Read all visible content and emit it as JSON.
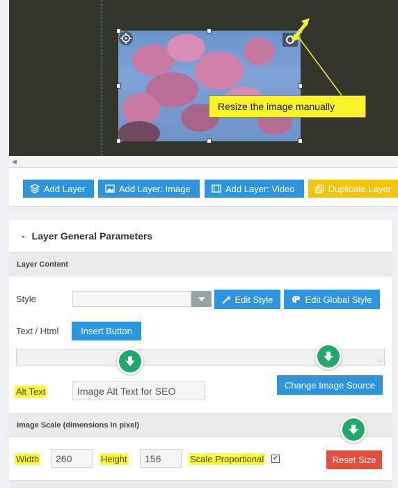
{
  "canvas": {
    "callout_text": "Resize the image manually"
  },
  "layer_buttons": [
    {
      "label": "Add Layer",
      "icon": "layers-icon"
    },
    {
      "label": "Add Layer: Image",
      "icon": "image-icon"
    },
    {
      "label": "Add Layer: Video",
      "icon": "film-icon"
    },
    {
      "label": "Duplicate Layer",
      "icon": "duplicate-icon"
    }
  ],
  "params": {
    "title": "Layer General Parameters",
    "collapse_symbol": "-",
    "layer_content_section": "Layer Content",
    "style_label": "Style",
    "edit_style": "Edit Style",
    "edit_global_style": "Edit Global Style",
    "text_html_label": "Text / Html",
    "insert_button": "Insert Button",
    "alt_text_label": "Alt Text",
    "alt_text_value": "Image Alt Text for SEO",
    "change_image_source": "Change Image Source",
    "image_scale_section": "Image Scale (dimensions in pixel)",
    "width_label": "Width",
    "width_value": "260",
    "height_label": "Height",
    "height_value": "156",
    "scale_proportional_label": "Scale Proportional",
    "scale_proportional_checked": true,
    "reset_size": "Reset Size"
  },
  "colors": {
    "accent_blue": "#2d94de",
    "accent_yellow": "#f1c40f",
    "danger_red": "#e74c3c",
    "arrow_green": "#21a86a",
    "highlight": "#fdfb3a"
  }
}
